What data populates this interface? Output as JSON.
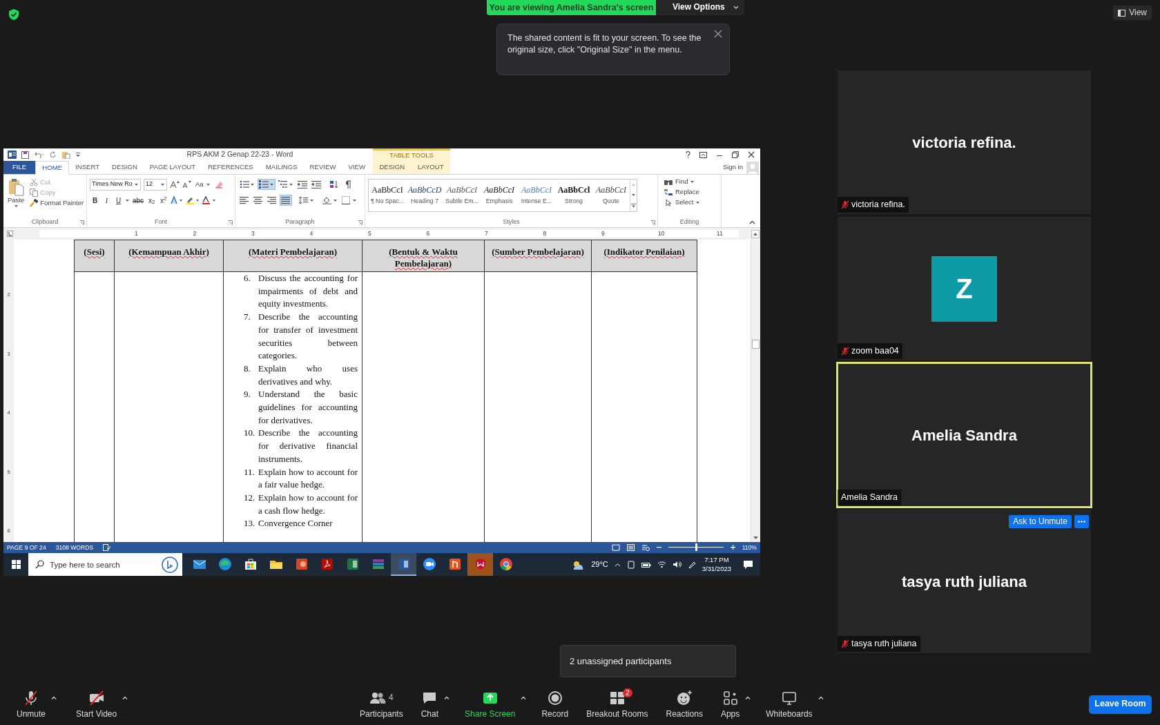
{
  "banner": {
    "text": "You are viewing Amelia Sandra's screen",
    "button": "View Options"
  },
  "tooltip": {
    "text": "The shared content is fit to your screen. To see the original size, click \"Original Size\" in the menu."
  },
  "view_button": "View",
  "word": {
    "title": "RPS AKM 2 Genap 22-23 - Word",
    "context_group": "TABLE TOOLS",
    "tabs": [
      {
        "label": "FILE",
        "kind": "file",
        "selected": false
      },
      {
        "label": "HOME",
        "kind": "main",
        "selected": true
      },
      {
        "label": "INSERT",
        "kind": "main",
        "selected": false
      },
      {
        "label": "DESIGN",
        "kind": "main",
        "selected": false
      },
      {
        "label": "PAGE LAYOUT",
        "kind": "main",
        "selected": false
      },
      {
        "label": "REFERENCES",
        "kind": "main",
        "selected": false
      },
      {
        "label": "MAILINGS",
        "kind": "main",
        "selected": false
      },
      {
        "label": "REVIEW",
        "kind": "main",
        "selected": false
      },
      {
        "label": "VIEW",
        "kind": "main",
        "selected": false
      },
      {
        "label": "DESIGN",
        "kind": "context",
        "selected": false
      },
      {
        "label": "LAYOUT",
        "kind": "context",
        "selected": false
      }
    ],
    "sign_in": "Sign in",
    "clipboard": {
      "paste": "Paste",
      "label": "Clipboard",
      "actions": [
        {
          "label": "Cut",
          "kind": "cut",
          "disabled": true
        },
        {
          "label": "Copy",
          "kind": "copy",
          "disabled": true
        },
        {
          "label": "Format Painter",
          "kind": "painter",
          "disabled": false
        }
      ]
    },
    "font": {
      "name": "Times New Ro",
      "size": "12",
      "change_case": "Aa",
      "format_buttons": [
        "B",
        "I",
        "U",
        "abc",
        "x$_{2}$",
        "x$^{2}$"
      ],
      "label": "Font"
    },
    "paragraph": {
      "label": "Paragraph",
      "row1": [
        {
          "kind": "bullets",
          "on": false
        },
        {
          "kind": "numbering",
          "on": true
        },
        {
          "kind": "multilevel",
          "on": false
        },
        {
          "kind": "outdent",
          "on": false
        },
        {
          "kind": "indent",
          "on": false
        },
        {
          "kind": "sort",
          "on": false
        },
        {
          "kind": "marks",
          "on": false
        }
      ],
      "row2": [
        {
          "kind": "left",
          "on": false
        },
        {
          "kind": "center",
          "on": false
        },
        {
          "kind": "right",
          "on": false
        },
        {
          "kind": "justify",
          "on": true
        },
        {
          "kind": "spacing",
          "on": false
        },
        {
          "kind": "shading",
          "on": false
        },
        {
          "kind": "borders",
          "on": false
        }
      ]
    },
    "styles": {
      "label": "Styles",
      "items": [
        {
          "sample": "AaBbCcI",
          "name": "¶ No Spac...",
          "kind": "normal"
        },
        {
          "sample": "AaBbCcD",
          "name": "Heading 7",
          "kind": "heading"
        },
        {
          "sample": "AaBbCcI",
          "name": "Subtle Em...",
          "kind": "subtle"
        },
        {
          "sample": "AaBbCcI",
          "name": "Emphasis",
          "kind": "emphasis"
        },
        {
          "sample": "AaBbCcI",
          "name": "Intense E...",
          "kind": "intense"
        },
        {
          "sample": "AaBbCcl",
          "name": "Strong",
          "kind": "strong"
        },
        {
          "sample": "AaBbCcI",
          "name": "Quote",
          "kind": "quote"
        }
      ]
    },
    "editing": {
      "find": "Find",
      "replace": "Replace",
      "select": "Select",
      "label": "Editing"
    },
    "ruler": [
      "1",
      "2",
      "3",
      "4",
      "5",
      "6",
      "7",
      "8",
      "9",
      "10",
      "11"
    ],
    "vertical_ruler": [
      "2",
      "3",
      "4",
      "5",
      "6"
    ],
    "table": {
      "headers": [
        "(Sesi)",
        "(Kemampuan Akhir)",
        "(Materi Pembelajaran)",
        "(Bentuk & Waktu Pembelajaran)",
        "(Sumber Pembelajaran)",
        "(Indikator Penilaian)"
      ],
      "items": [
        {
          "number": "6.",
          "text": "Discuss the accounting for impairments of debt and equity investments."
        },
        {
          "number": "7.",
          "text": "Describe the accounting for transfer of investment securities between categories."
        },
        {
          "number": "8.",
          "text": "Explain who uses derivatives and why."
        },
        {
          "number": "9.",
          "text": "Understand the basic guidelines for accounting for derivatives."
        },
        {
          "number": "10.",
          "text": "Describe the accounting for derivative financial instruments."
        },
        {
          "number": "11.",
          "text": "Explain how to account for a fair value hedge."
        },
        {
          "number": "12.",
          "text": "Explain how to account for a cash flow hedge."
        },
        {
          "number": "13.",
          "text": "Convergence Corner"
        }
      ]
    },
    "status": {
      "page": "PAGE 9 OF 24",
      "words": "3108 WORDS",
      "zoom": "110%",
      "zoom_slider": {
        "level": 0.5
      }
    }
  },
  "taskbar": {
    "search_placeholder": "Type here to search",
    "weather": "29°C",
    "time": "7:17 PM",
    "date": "3/31/2023",
    "apps": [
      {
        "kind": "mail",
        "active": false
      },
      {
        "kind": "edge",
        "active": false
      },
      {
        "kind": "store",
        "active": false
      },
      {
        "kind": "folder",
        "active": false
      },
      {
        "kind": "slides",
        "active": false
      },
      {
        "kind": "pdf",
        "active": false
      },
      {
        "kind": "sheet",
        "active": false
      },
      {
        "kind": "archive",
        "active": false
      },
      {
        "kind": "doc",
        "active": true
      },
      {
        "kind": "meet",
        "active": false
      },
      {
        "kind": "orange",
        "active": false
      },
      {
        "kind": "shield",
        "active": false
      },
      {
        "kind": "chrome",
        "active": false
      }
    ]
  },
  "participants": [
    {
      "kind": "name",
      "title": "victoria refina.",
      "label": "victoria refina.",
      "muted": true,
      "speaking": false
    },
    {
      "kind": "avatar",
      "initial": "Z",
      "color": "#0e9aa7",
      "label": "zoom baa04",
      "muted": true,
      "speaking": false
    },
    {
      "kind": "name",
      "title": "Amelia Sandra",
      "label": "Amelia Sandra",
      "muted": false,
      "speaking": true
    },
    {
      "kind": "name",
      "title": "tasya ruth juliana",
      "label": "tasya ruth juliana",
      "muted": true,
      "speaking": false,
      "action": "Ask to Unmute"
    }
  ],
  "popover": "2 unassigned participants",
  "toolbar": [
    {
      "label": "Unmute",
      "kind": "mic",
      "caret": true
    },
    {
      "label": "Start Video",
      "kind": "video",
      "caret": true
    },
    {
      "label": "Participants",
      "kind": "participants",
      "count": "4",
      "caret": false
    },
    {
      "label": "Chat",
      "kind": "chat",
      "caret": true
    },
    {
      "label": "Share Screen",
      "kind": "share",
      "caret": true
    },
    {
      "label": "Record",
      "kind": "record",
      "caret": false
    },
    {
      "label": "Breakout Rooms",
      "kind": "breakout",
      "badge": "2",
      "caret": false
    },
    {
      "label": "Reactions",
      "kind": "reactions",
      "caret": false
    },
    {
      "label": "Apps",
      "kind": "apps",
      "caret": true
    },
    {
      "label": "Whiteboards",
      "kind": "whiteboard",
      "caret": true
    }
  ],
  "leave": "Leave Room"
}
